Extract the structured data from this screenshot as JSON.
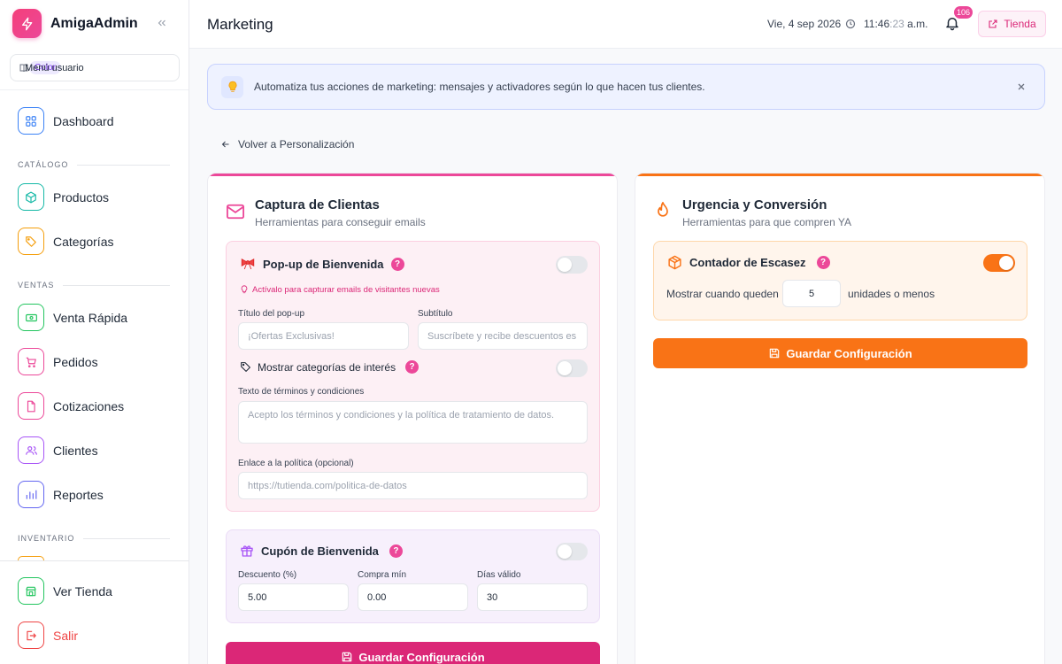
{
  "sidebar": {
    "brand": "AmigaAdmin",
    "user_menu": {
      "label": "Menú usuario",
      "badge": "Color"
    },
    "sections": {
      "catalog": "CATÁLOGO",
      "sales": "VENTAS",
      "inventory": "INVENTARIO"
    },
    "items": [
      {
        "label": "Dashboard",
        "icon": "grid-icon",
        "color": "#3b82f6"
      },
      {
        "label": "Productos",
        "icon": "box-icon",
        "color": "#14b8a6"
      },
      {
        "label": "Categorías",
        "icon": "tag-icon",
        "color": "#f59e0b"
      },
      {
        "label": "Venta Rápida",
        "icon": "cash-icon",
        "color": "#22c55e"
      },
      {
        "label": "Pedidos",
        "icon": "cart-icon",
        "color": "#ec4899"
      },
      {
        "label": "Cotizaciones",
        "icon": "document-icon",
        "color": "#ec4899"
      },
      {
        "label": "Clientes",
        "icon": "users-icon",
        "color": "#a855f7"
      },
      {
        "label": "Reportes",
        "icon": "chart-icon",
        "color": "#6366f1"
      }
    ],
    "bottom": [
      {
        "label": "Ver Tienda",
        "icon": "store-icon",
        "color": "#22c55e"
      },
      {
        "label": "Salir",
        "icon": "logout-icon",
        "color": "#ef4444"
      }
    ]
  },
  "header": {
    "title": "Marketing",
    "date": "Vie, 4 sep 2026",
    "time_main": "11:46",
    "time_sec": ":23",
    "time_suffix": " a.m.",
    "notifications": "106",
    "store_button": "Tienda"
  },
  "banner": {
    "text": "Automatiza tus acciones de marketing: mensajes y activadores según lo que hacen tus clientes."
  },
  "back_link": "Volver a Personalización",
  "capture": {
    "title": "Captura de Clientas",
    "subtitle": "Herramientas para conseguir emails",
    "popup": {
      "title": "Pop-up de Bienvenida",
      "help": "?",
      "hint": "Actívalo para capturar emails de visitantes nuevas",
      "enabled": false,
      "title_label": "Título del pop-up",
      "title_placeholder": "¡Ofertas Exclusivas!",
      "subtitle_label": "Subtítulo",
      "subtitle_placeholder": "Suscríbete y recibe descuentos es",
      "categories_label": "Mostrar categorías de interés",
      "categories_enabled": false,
      "terms_label": "Texto de términos y condiciones",
      "terms_placeholder": "Acepto los términos y condiciones y la política de tratamiento de datos.",
      "policy_label": "Enlace a la política (opcional)",
      "policy_placeholder": "https://tutienda.com/politica-de-datos"
    },
    "coupon": {
      "title": "Cupón de Bienvenida",
      "enabled": false,
      "discount_label": "Descuento (%)",
      "discount_value": "5.00",
      "min_label": "Compra mín",
      "min_value": "0.00",
      "days_label": "Días válido",
      "days_value": "30"
    },
    "save": "Guardar Configuración"
  },
  "urgency": {
    "title": "Urgencia y Conversión",
    "subtitle": "Herramientas para que compren YA",
    "scarcity": {
      "title": "Contador de Escasez",
      "enabled": true,
      "prefix": "Mostrar cuando queden",
      "value": "5",
      "suffix": "unidades o menos"
    },
    "save": "Guardar Configuración"
  },
  "colors": {
    "pink": "#db2777",
    "orange": "#f97316"
  }
}
